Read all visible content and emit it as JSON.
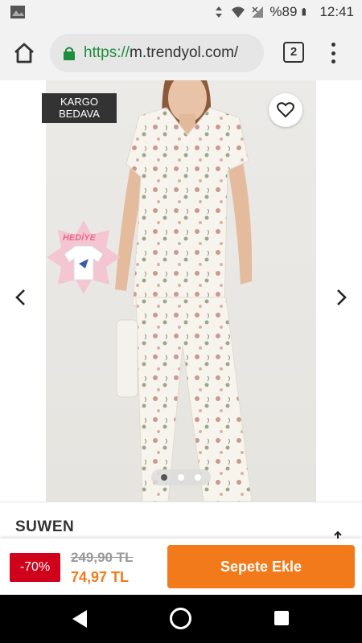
{
  "status_bar": {
    "battery_text": "%89",
    "time": "12:41"
  },
  "browser": {
    "url_scheme": "https://",
    "url_host": "m.trendyol.com/",
    "tab_count": "2"
  },
  "product": {
    "badge_line1": "KARGO",
    "badge_line2": "BEDAVA",
    "gift_label": "HEDİYE",
    "gallery_index": 1,
    "gallery_total": 3,
    "brand": "SUWEN"
  },
  "buy_bar": {
    "discount": "-70%",
    "old_price": "249,90 TL",
    "new_price": "74,97 TL",
    "cta": "Sepete Ekle"
  },
  "colors": {
    "accent": "#f27a1a",
    "discount_bg": "#d0021b",
    "url_scheme": "#1e8e3e"
  }
}
